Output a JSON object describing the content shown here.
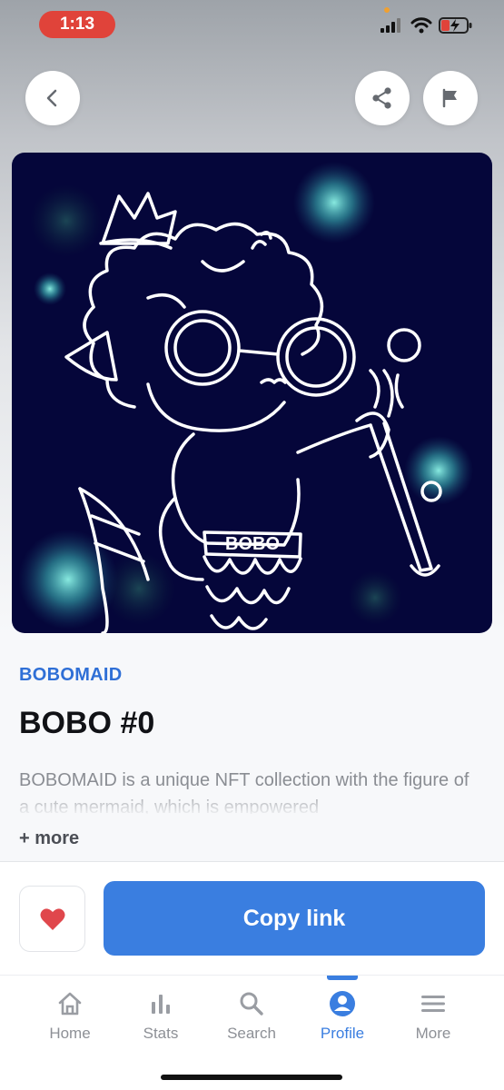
{
  "status_bar": {
    "time": "1:13"
  },
  "header": {
    "back_icon": "chevron-left-icon",
    "share_icon": "share-icon",
    "report_icon": "flag-icon"
  },
  "artwork": {
    "badge_text": "BOBO"
  },
  "item": {
    "collection": "BOBOMAID",
    "title": "BOBO #0",
    "description": "BOBOMAID is a unique NFT collection with the figure of a cute mermaid, which is empowered",
    "more_label": "+ more"
  },
  "actions": {
    "copy_label": "Copy link",
    "favorite_icon": "heart-icon"
  },
  "nav": {
    "items": [
      {
        "label": "Home",
        "icon": "home-icon"
      },
      {
        "label": "Stats",
        "icon": "stats-icon"
      },
      {
        "label": "Search",
        "icon": "search-icon"
      },
      {
        "label": "Profile",
        "icon": "profile-icon"
      },
      {
        "label": "More",
        "icon": "menu-icon"
      }
    ],
    "active": "Profile"
  },
  "colors": {
    "accent": "#3a7ee0",
    "heart": "#e0474c",
    "time_pill": "#e0433a",
    "artwork_bg": "#05063a"
  }
}
